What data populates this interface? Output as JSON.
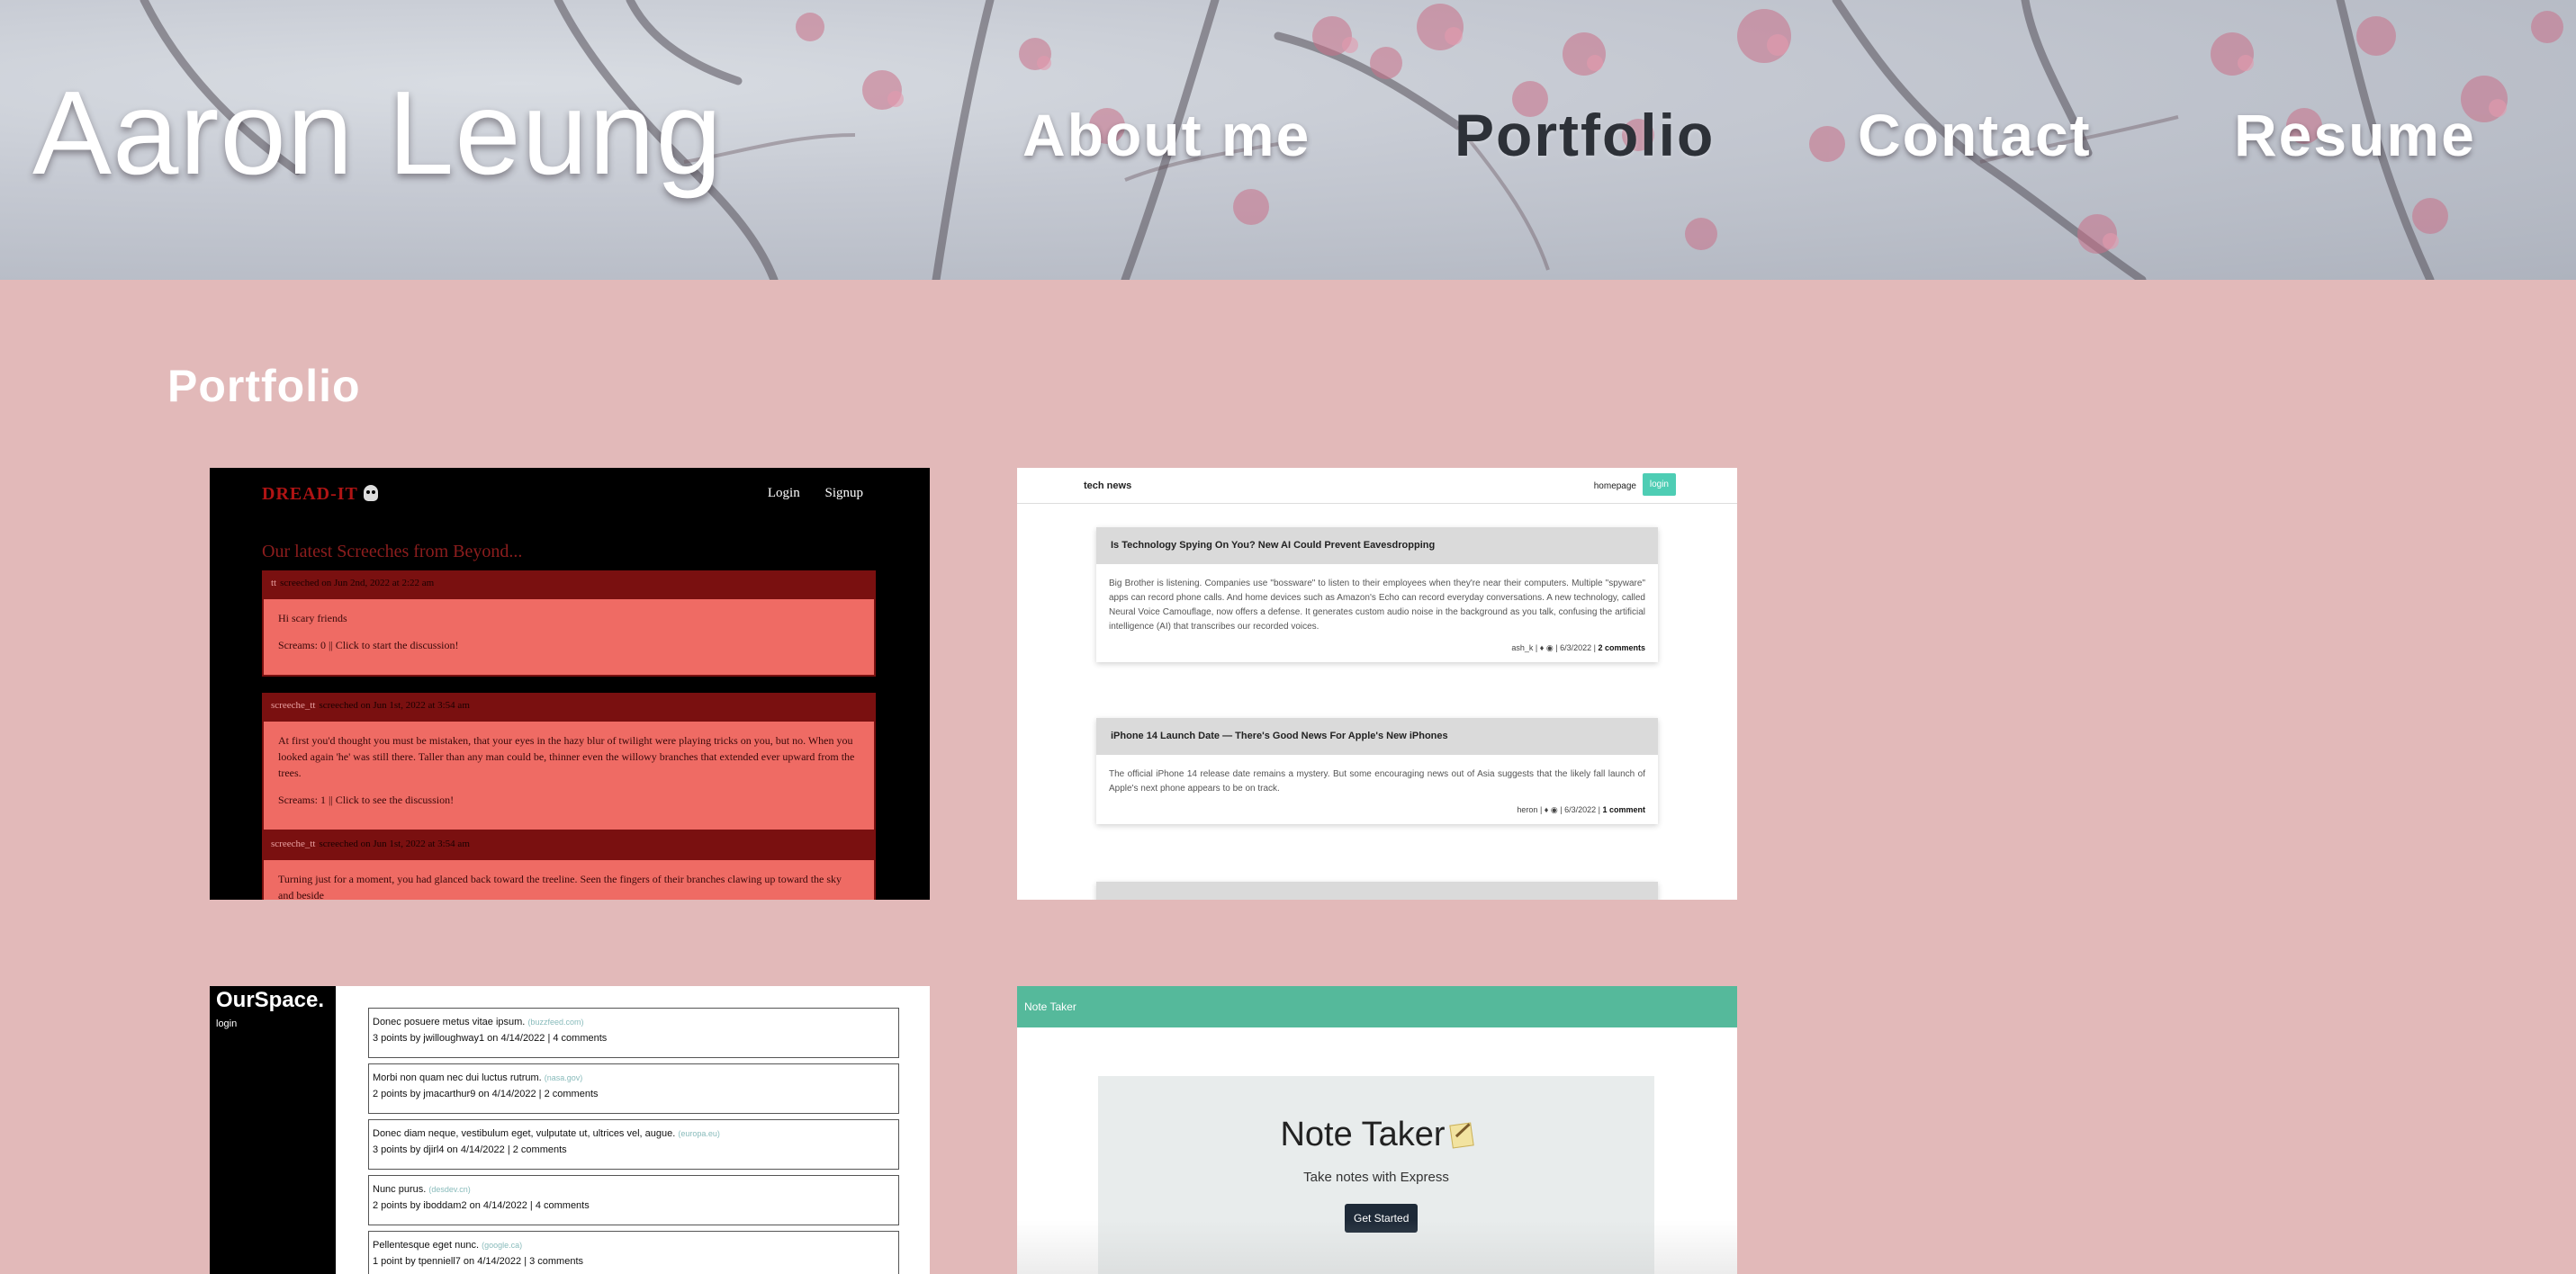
{
  "header": {
    "site_title": "Aaron Leung",
    "nav": [
      "About me",
      "Portfolio",
      "Contact",
      "Resume"
    ]
  },
  "colors": {
    "page_background": "#e2b9b9",
    "active_nav": "#2d3138",
    "nav_text": "#ffffff"
  },
  "portfolio": {
    "title": "Portfolio",
    "dreadit": {
      "logo": "DREAD-IT",
      "nav": [
        "Login",
        "Signup"
      ],
      "heading": "Our latest Screeches from Beyond...",
      "posts": [
        {
          "user": "tt",
          "meta": "screeched on Jun 2nd, 2022 at 2:22 am",
          "body": [
            "Hi scary friends"
          ],
          "footer": "Screams: 0 || Click to start the discussion!"
        },
        {
          "user": "screeche_tt",
          "meta": "screeched on Jun 1st, 2022 at 3:54 am",
          "body": [
            "At first you'd thought you must be mistaken, that your eyes in the hazy blur of twilight were playing tricks on you, but no. When you looked again 'he' was still there. Taller than any man could be, thinner even the willowy branches that extended ever upward from the trees."
          ],
          "footer": "Screams: 1 || Click to see the discussion!"
        },
        {
          "user": "screeche_tt",
          "meta": "screeched on Jun 1st, 2022 at 3:54 am",
          "body": [
            "Turning just for a moment, you had glanced back toward the treeline. Seen the fingers of their branches clawing up toward the sky and beside"
          ],
          "footer": ""
        }
      ]
    },
    "technews": {
      "brand": "tech news",
      "homepage": "homepage",
      "login": "login",
      "articles": [
        {
          "title": "Is Technology Spying On You? New AI Could Prevent Eavesdropping",
          "body": "Big Brother is listening. Companies use \"bossware\" to listen to their employees when they're near their computers. Multiple \"spyware\" apps can record phone calls. And home devices such as Amazon's Echo can record everyday conversations. A new technology, called Neural Voice Camouflage, now offers a defense. It generates custom audio noise in the background as you talk, confusing the artificial intelligence (AI) that transcribes our recorded voices.",
          "author": "ash_k",
          "date": "6/3/2022",
          "comments": "2 comments"
        },
        {
          "title": "iPhone 14 Launch Date — There's Good News For Apple's New iPhones",
          "body": "The official iPhone 14 release date remains a mystery. But some encouraging news out of Asia suggests that the likely fall launch of Apple's next phone appears to be on track.",
          "author": "heron",
          "date": "6/3/2022",
          "comments": "1 comment"
        }
      ]
    },
    "ourspace": {
      "brand": "OurSpace.",
      "login": "login",
      "items": [
        {
          "title": "Donec posuere metus vitae ipsum.",
          "domain": "(buzzfeed.com)",
          "meta": "3 points by jwilloughway1 on 4/14/2022 | 4 comments"
        },
        {
          "title": "Morbi non quam nec dui luctus rutrum.",
          "domain": "(nasa.gov)",
          "meta": "2 points by jmacarthur9 on 4/14/2022 | 2 comments"
        },
        {
          "title": "Donec diam neque, vestibulum eget, vulputate ut, ultrices vel, augue.",
          "domain": "(europa.eu)",
          "meta": "3 points by djirl4 on 4/14/2022 | 2 comments"
        },
        {
          "title": "Nunc purus.",
          "domain": "(desdev.cn)",
          "meta": "2 points by iboddam2 on 4/14/2022 | 4 comments"
        },
        {
          "title": "Pellentesque eget nunc.",
          "domain": "(google.ca)",
          "meta": "1 point by tpenniell7 on 4/14/2022 | 3 comments"
        }
      ]
    },
    "notetaker": {
      "bar_title": "Note Taker",
      "title": "Note Taker",
      "subtitle": "Take notes with Express",
      "button": "Get Started"
    }
  }
}
